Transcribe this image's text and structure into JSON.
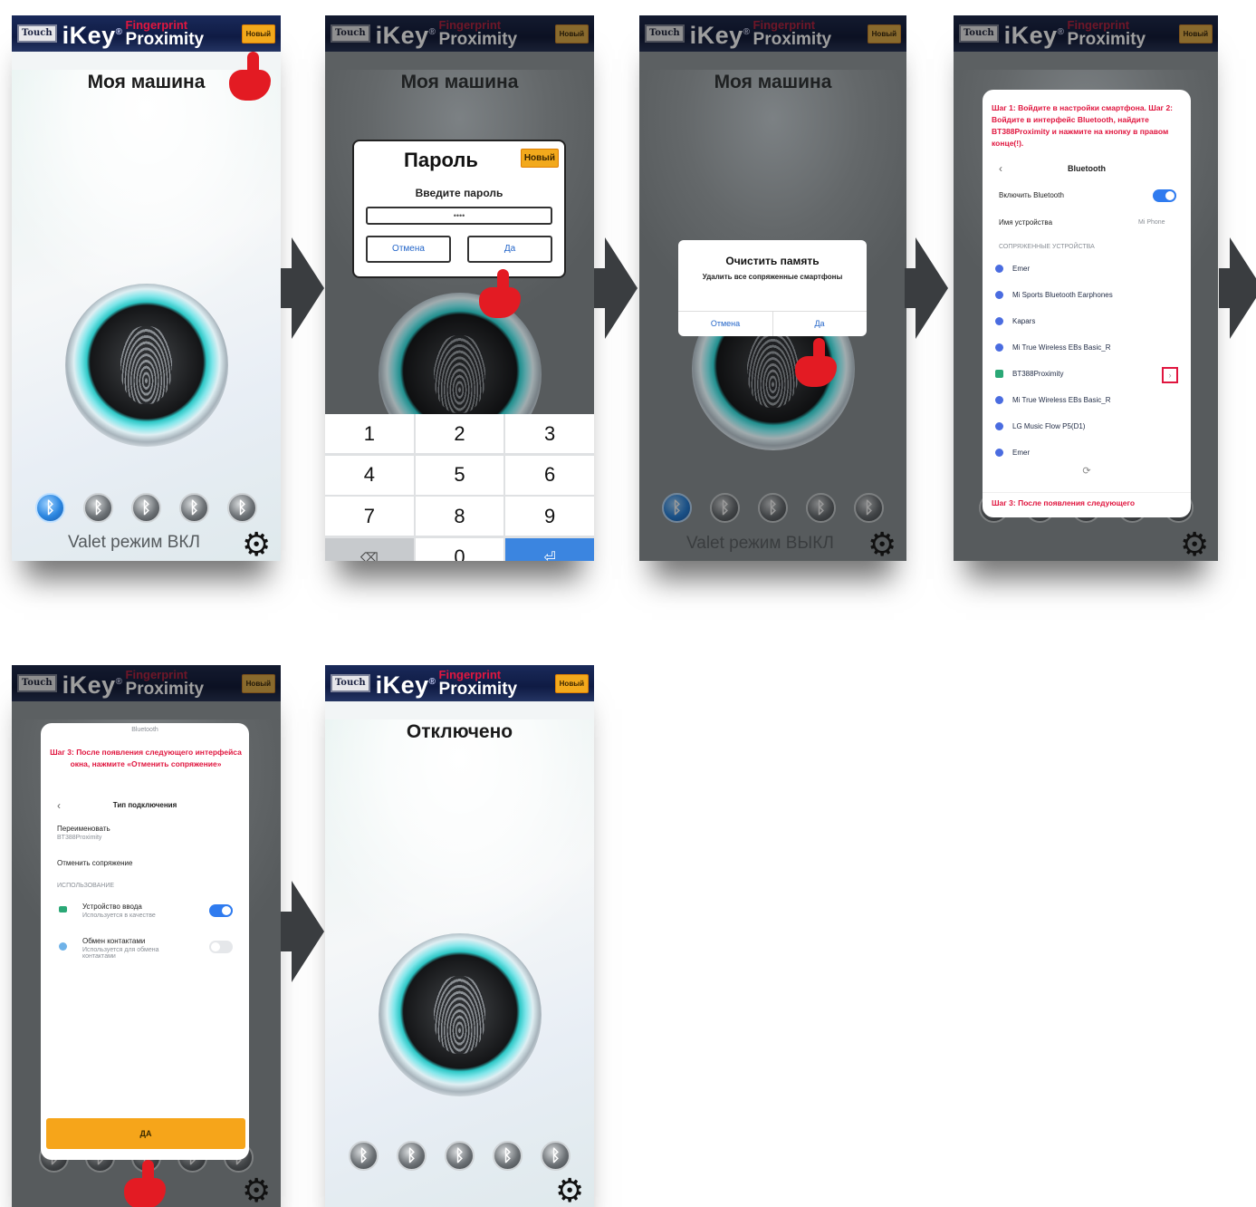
{
  "app": {
    "touch_badge": "Touch",
    "brand_main": "iKey",
    "brand_reg": "®",
    "brand_top": "Fingerprint",
    "brand_bottom": "Proximity",
    "new_badge": "Новый"
  },
  "screen1": {
    "title": "Моя машина",
    "valet_text": "Valet режим ВКЛ",
    "bluetooth_glyph": "ᛒ"
  },
  "screen2": {
    "title": "Моя машина",
    "dialog_title": "Пароль",
    "dialog_badge": "Новый",
    "dialog_prompt": "Введите пароль",
    "password_value": "••••",
    "cancel_label": "Отмена",
    "ok_label": "Да",
    "keys": [
      "1",
      "2",
      "3",
      "4",
      "5",
      "6",
      "7",
      "8",
      "9",
      "⌫",
      "0",
      "⏎"
    ]
  },
  "screen3": {
    "title": "Моя машина",
    "dialog_title": "Очистить память",
    "dialog_text": "Удалить все сопряженные смартфоны",
    "cancel_label": "Отмена",
    "ok_label": "Да",
    "valet_text": "Valet режим ВЫКЛ"
  },
  "screen4": {
    "step_text": "Шаг 1: Войдите в настройки смартфона. Шаг 2: Войдите в интерфейс Bluetooth, найдите BT388Proximity и нажмите на кнопку в правом конце(!).",
    "panel_title": "Bluetooth",
    "enable_label": "Включить Bluetooth",
    "device_name_label": "Имя устройства",
    "device_name_value": "Mi Phone",
    "section_label": "СОПРЯЖЕННЫЕ УСТРОЙСТВА",
    "devices": [
      "Emer",
      "Mi Sports Bluetooth Earphones",
      "Kapars",
      "Mi True Wireless EBs Basic_R",
      "BT388Proximity",
      "Mi True Wireless EBs Basic_R",
      "LG Music Flow P5(D1)",
      "Emer"
    ],
    "bottom_step": "Шаг 3: После появления следующего"
  },
  "screen5": {
    "top_label": "Bluetooth",
    "step_text": "Шаг 3: После появления следующего интерфейса окна, нажмите «Отменить сопряжение»",
    "panel_title": "Тип подключения",
    "rename_label": "Переименовать",
    "rename_sub": "BT388Proximity",
    "unpair_label": "Отменить сопряжение",
    "section_label": "ИСПОЛЬЗОВАНИЕ",
    "input_device_label": "Устройство ввода",
    "input_device_sub": "Используется в качестве",
    "contacts_label": "Обмен контактами",
    "contacts_sub": "Используется для обмена контактами",
    "yes_label": "ДА"
  },
  "screen6": {
    "title": "Отключено"
  }
}
